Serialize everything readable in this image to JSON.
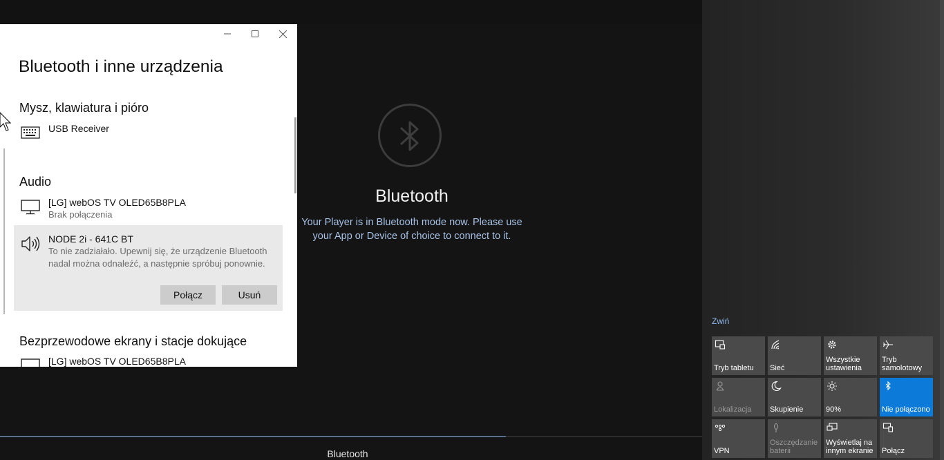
{
  "player": {
    "title": "Bluetooth",
    "message": "Your Player is in Bluetooth mode now. Please use your App or Device of choice to connect to it.",
    "bottom_label": "Bluetooth",
    "progress": 0.72
  },
  "window": {
    "title": "Bluetooth i inne urządzenia",
    "sections": {
      "input": "Mysz, klawiatura i pióro",
      "audio": "Audio",
      "wireless": "Bezprzewodowe ekrany i stacje dokujące"
    },
    "devices": {
      "usb_receiver": {
        "name": "USB Receiver"
      },
      "lg_tv_audio": {
        "name": "[LG] webOS TV OLED65B8PLA",
        "status": "Brak połączenia"
      },
      "node": {
        "name": "NODE 2i - 641C BT",
        "error": "To nie zadziałało. Upewnij się, że urządzenie Bluetooth nadal można odnaleźć, a następnie spróbuj ponownie."
      },
      "lg_tv_display": {
        "name": "[LG] webOS TV OLED65B8PLA"
      }
    },
    "buttons": {
      "connect": "Połącz",
      "remove": "Usuń"
    }
  },
  "action_center": {
    "collapse": "Zwiń",
    "tiles": [
      {
        "label": "Tryb tabletu",
        "icon": "tablet-mode-icon",
        "state": "normal"
      },
      {
        "label": "Sieć",
        "icon": "network-icon",
        "state": "normal"
      },
      {
        "label": "Wszystkie ustawienia",
        "icon": "gear-icon",
        "state": "normal"
      },
      {
        "label": "Tryb samolotowy",
        "icon": "airplane-icon",
        "state": "normal"
      },
      {
        "label": "Lokalizacja",
        "icon": "location-icon",
        "state": "dim"
      },
      {
        "label": "Skupienie",
        "icon": "moon-icon",
        "state": "normal"
      },
      {
        "label": "90%",
        "icon": "brightness-icon",
        "state": "normal"
      },
      {
        "label": "Nie połączono",
        "icon": "bluetooth-icon",
        "state": "on"
      },
      {
        "label": "VPN",
        "icon": "vpn-icon",
        "state": "normal"
      },
      {
        "label": "Oszczędzanie baterii",
        "icon": "battery-saver-icon",
        "state": "dim"
      },
      {
        "label": "Wyświetlaj na innym ekranie",
        "icon": "project-icon",
        "state": "normal"
      },
      {
        "label": "Połącz",
        "icon": "connect-icon",
        "state": "normal"
      }
    ]
  },
  "colors": {
    "accent": "#0c7ad8",
    "tile": "#4a4a4a",
    "link": "#8fb8ea",
    "player_text": "#a9c3e8"
  }
}
